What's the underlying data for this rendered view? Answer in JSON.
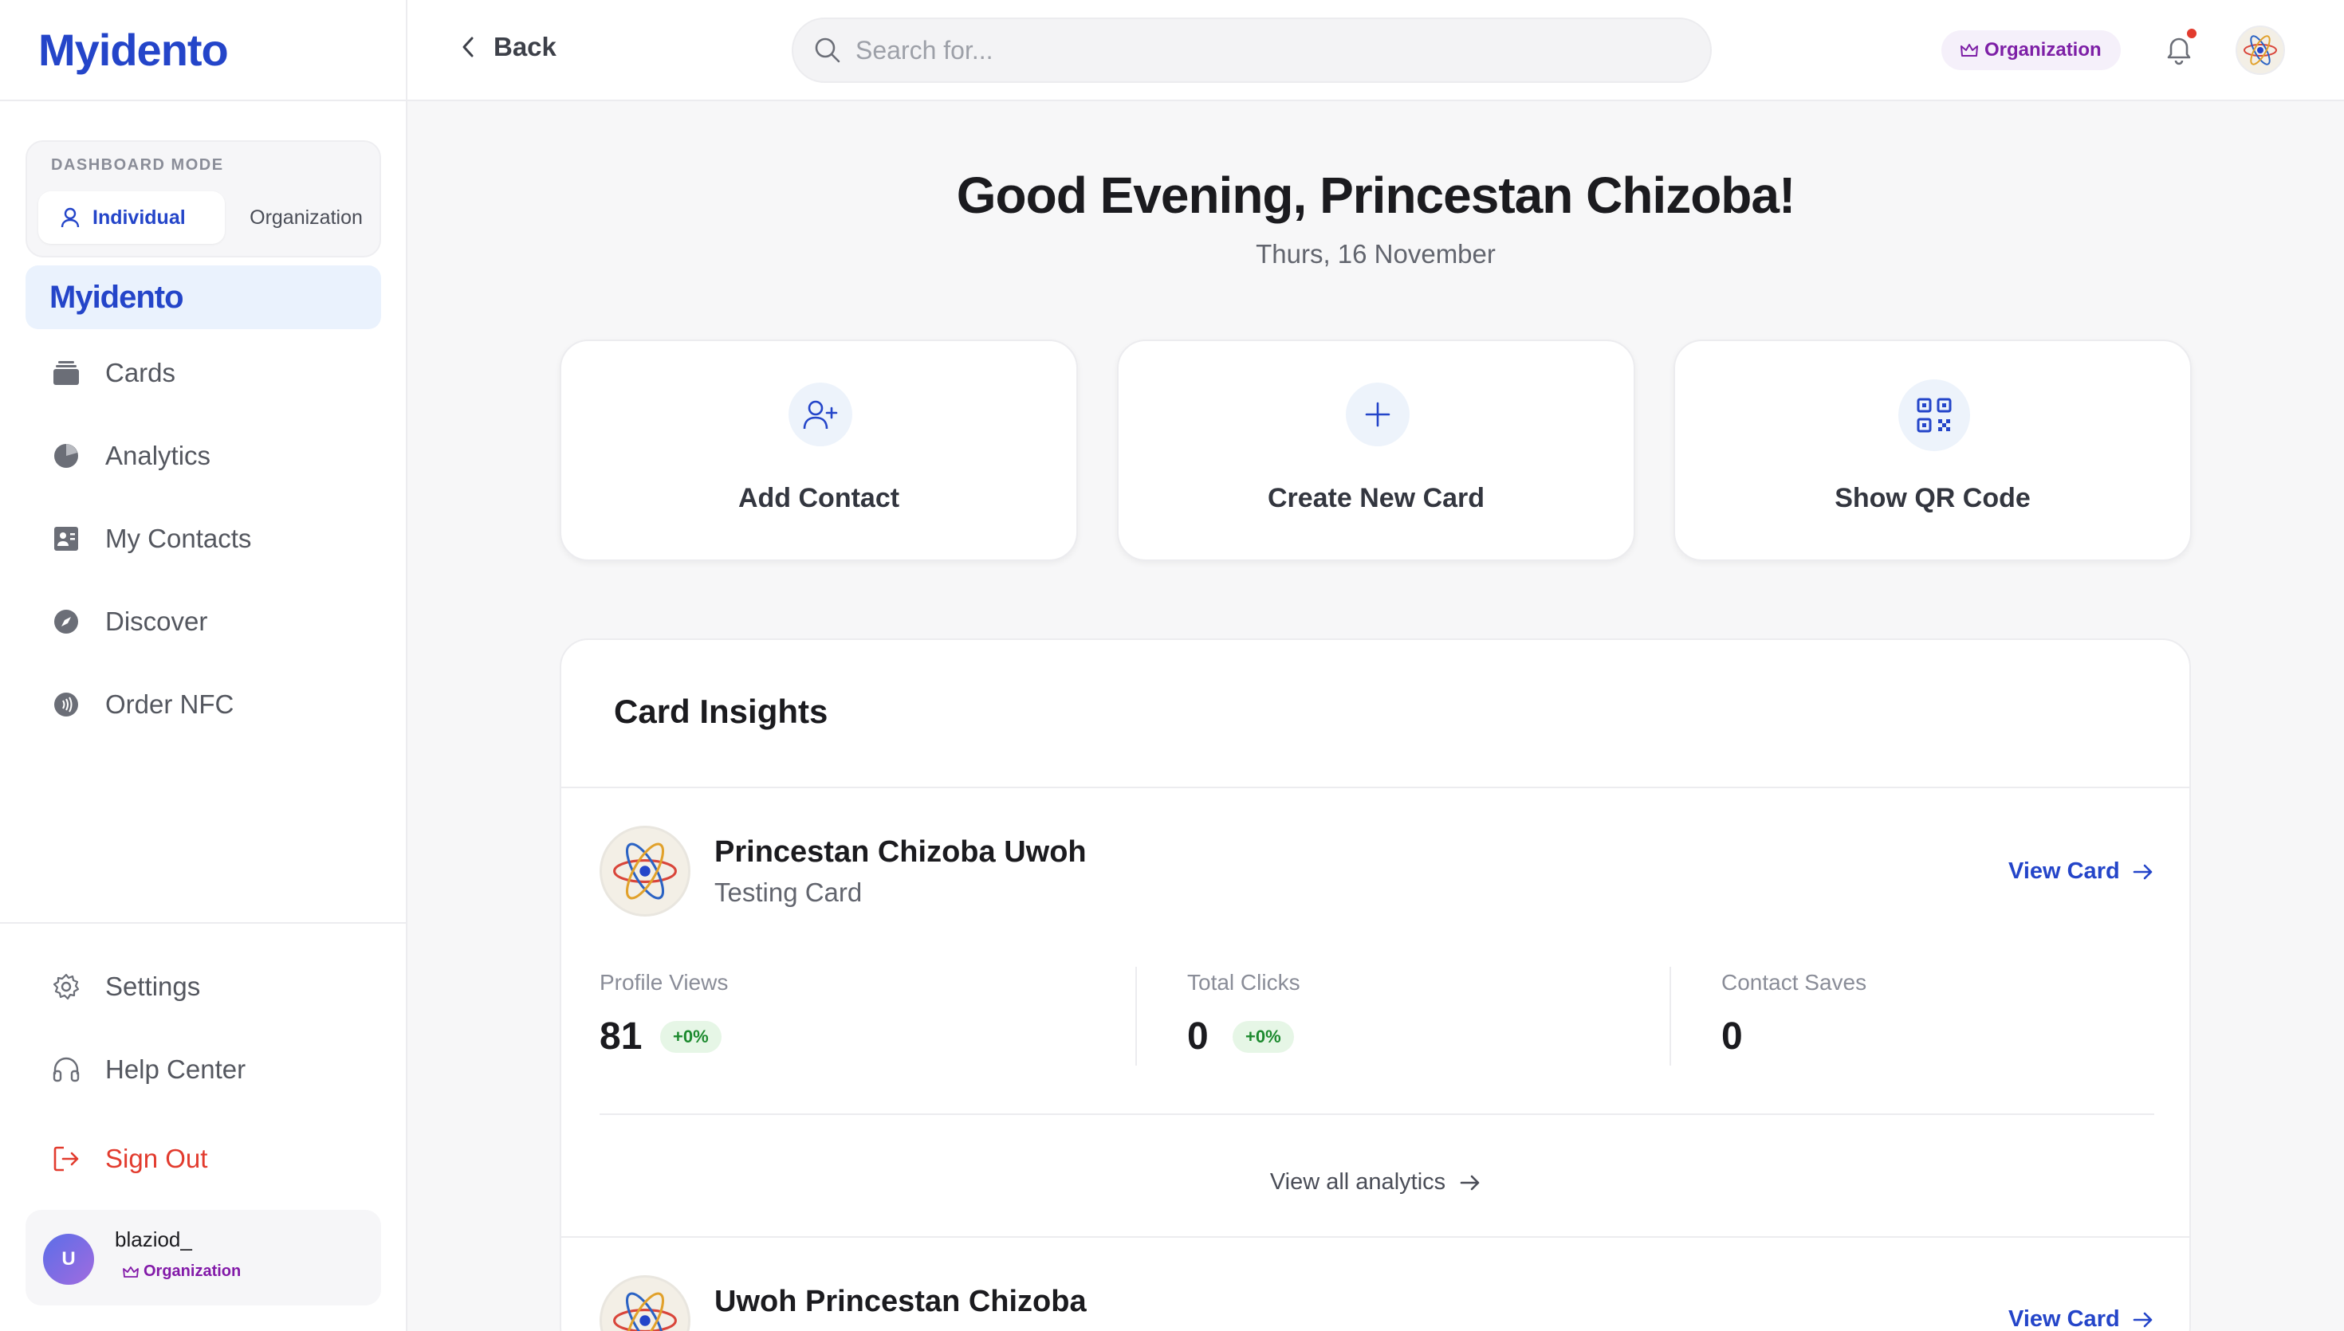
{
  "brand": {
    "name": "Myidento"
  },
  "sidebar": {
    "mode_label": "DASHBOARD MODE",
    "mode_individual": "Individual",
    "mode_organization": "Organization",
    "nav": [
      {
        "label": "Cards",
        "icon": "cards-icon"
      },
      {
        "label": "Analytics",
        "icon": "pie-chart-icon"
      },
      {
        "label": "My Contacts",
        "icon": "contacts-icon"
      },
      {
        "label": "Discover",
        "icon": "compass-icon"
      },
      {
        "label": "Order NFC",
        "icon": "nfc-icon"
      }
    ],
    "bottom": [
      {
        "label": "Settings",
        "icon": "gear-icon"
      },
      {
        "label": "Help Center",
        "icon": "headphones-icon"
      },
      {
        "label": "Sign Out",
        "icon": "sign-out-icon"
      }
    ],
    "user": {
      "initial": "U",
      "name": "blaziod_",
      "badge": "Organization"
    }
  },
  "topbar": {
    "back_label": "Back",
    "search_placeholder": "Search for...",
    "org_badge": "Organization"
  },
  "main": {
    "greeting": "Good Evening, Princestan Chizoba!",
    "date": "Thurs, 16 November",
    "actions": [
      {
        "label": "Add Contact",
        "icon": "add-user-icon"
      },
      {
        "label": "Create New Card",
        "icon": "plus-icon"
      },
      {
        "label": "Show QR Code",
        "icon": "qr-code-icon"
      }
    ],
    "insights": {
      "title": "Card Insights",
      "cards": [
        {
          "name": "Princestan Chizoba Uwoh",
          "subtitle": "Testing Card",
          "view_label": "View Card",
          "stats": [
            {
              "label": "Profile Views",
              "value": "81",
              "change": "+0%"
            },
            {
              "label": "Total Clicks",
              "value": "0",
              "change": "+0%"
            },
            {
              "label": "Contact Saves",
              "value": "0"
            }
          ],
          "view_all": "View all analytics"
        },
        {
          "name": "Uwoh Princestan Chizoba",
          "view_label": "View Card"
        }
      ]
    }
  },
  "colors": {
    "brand_blue": "#2445c9",
    "signout_red": "#e23b2e",
    "org_purple": "#7d1fa6",
    "badge_green": "#1c8a2e"
  }
}
